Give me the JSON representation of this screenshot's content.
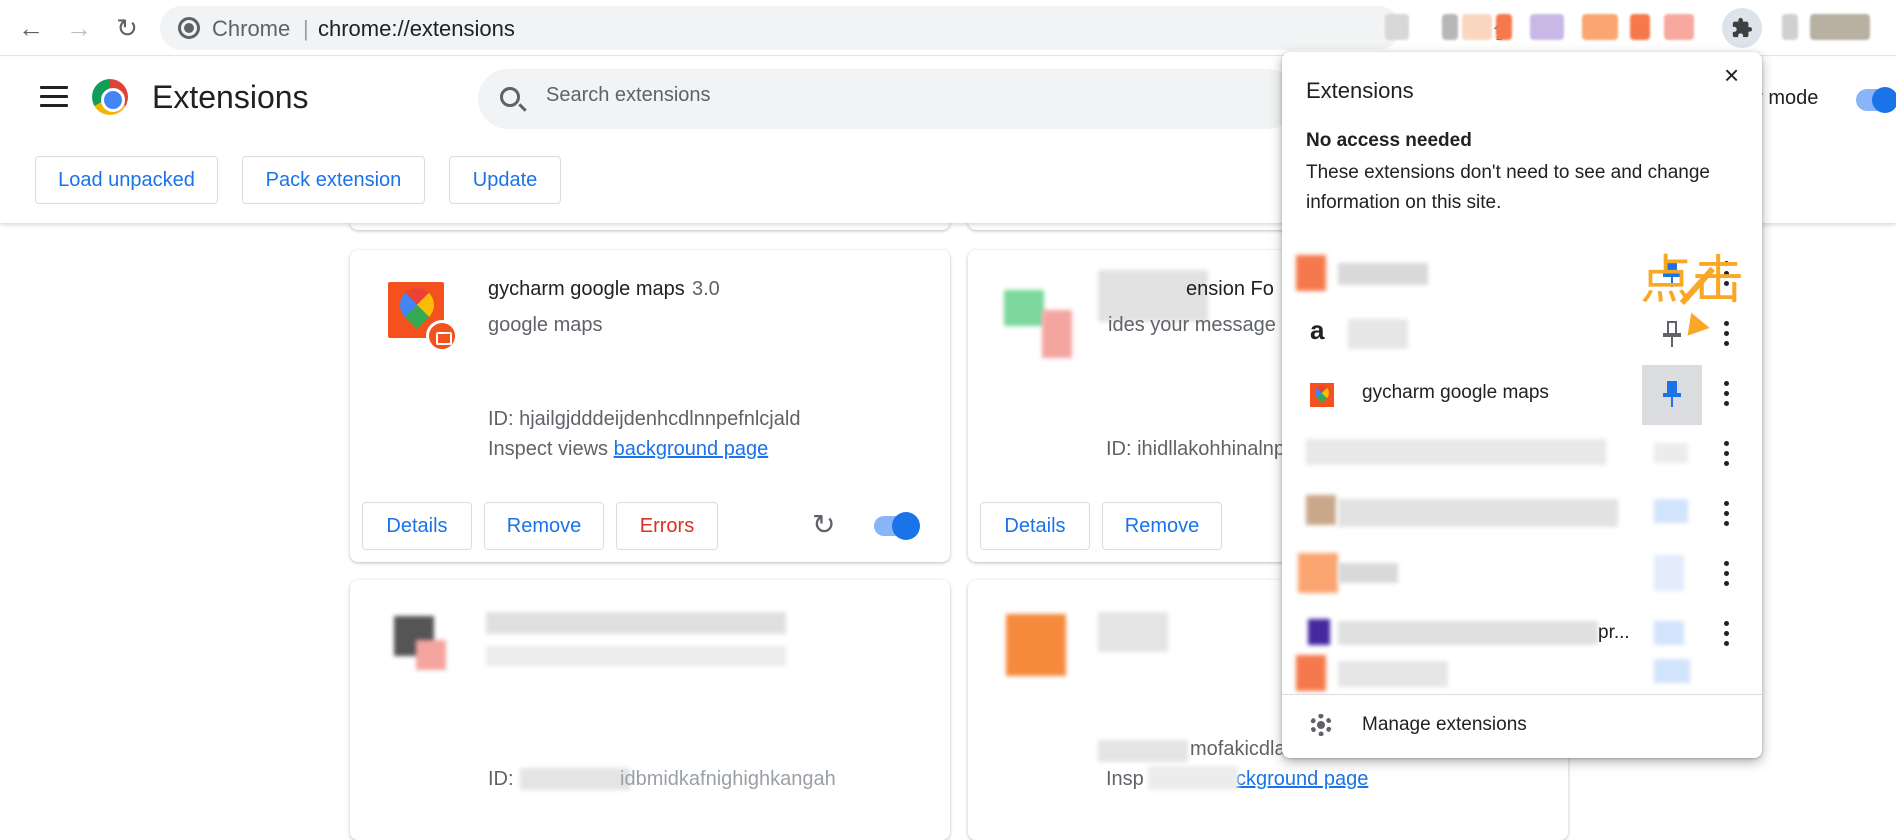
{
  "browser": {
    "omnibox_site": "Chrome",
    "omnibox_url": "chrome://extensions"
  },
  "header": {
    "title": "Extensions",
    "search_placeholder": "Search extensions",
    "developer_mode_label": "er mode",
    "buttons": {
      "load_unpacked": "Load unpacked",
      "pack_extension": "Pack extension",
      "update": "Update"
    }
  },
  "cards": [
    {
      "name": "gycharm google maps",
      "version": "3.0",
      "description": "google maps",
      "id": "ID: hjailgjdddeijdenhcdlnnpefnlcjald",
      "inspect_label": "Inspect views",
      "inspect_link": "background page",
      "details": "Details",
      "remove": "Remove",
      "errors": "Errors",
      "enabled": true
    },
    {
      "name_partial": "ension Fo",
      "description_partial": "ides your message",
      "id_partial": "ID: ihidllakohhinalnp",
      "details": "Details",
      "remove": "Remove"
    },
    {
      "id_partial": "ID:",
      "id_tail": "idbmidkafnighighkangah"
    },
    {
      "id_partial": "mofakicdla",
      "inspect_partial": "Insp",
      "inspect_link": "ckground page"
    }
  ],
  "popup": {
    "title": "Extensions",
    "close": "×",
    "section_title": "No access needed",
    "section_note": "These extensions don't need to see and change information on this site.",
    "highlighted_item": "gycharm google maps",
    "amazon_icon": "a",
    "truncated_item": "pr...",
    "manage_label": "Manage extensions"
  },
  "annotation": {
    "text": "点击",
    "color": "#f9a825"
  },
  "colors": {
    "accent": "#1a73e8",
    "error": "#d93025"
  }
}
